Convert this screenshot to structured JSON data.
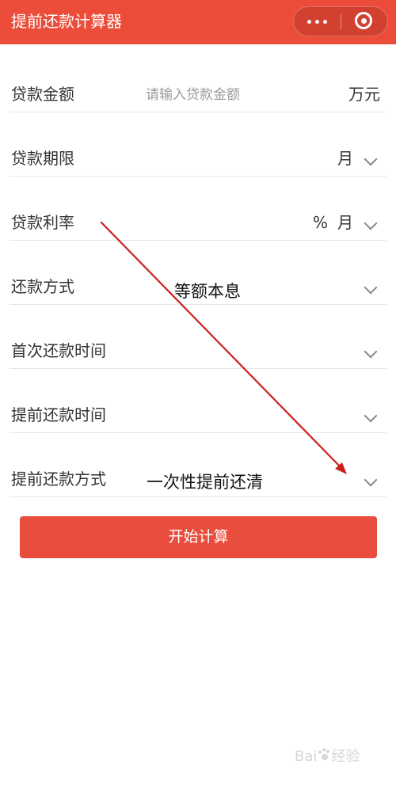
{
  "header": {
    "title": "提前还款计算器",
    "more_icon": "more-dots-icon",
    "close_icon": "target-close-icon"
  },
  "form": {
    "loan_amount": {
      "label": "贷款金额",
      "placeholder": "请输入贷款金额",
      "value": "",
      "unit": "万元"
    },
    "loan_term": {
      "label": "贷款期限",
      "unit": "月"
    },
    "loan_rate": {
      "label": "贷款利率",
      "percent": "%",
      "unit": "月"
    },
    "repay_method": {
      "label": "还款方式",
      "selected": "等额本息"
    },
    "first_repay_time": {
      "label": "首次还款时间"
    },
    "prepay_time": {
      "label": "提前还款时间"
    },
    "prepay_method": {
      "label": "提前还款方式",
      "selected": "一次性提前还清"
    }
  },
  "submit_button": {
    "label": "开始计算"
  },
  "annotation": {
    "color": "#cc1f1f"
  },
  "watermark": {
    "text": "Bai",
    "suffix": "经验"
  },
  "colors": {
    "brand": "#ec4d3b",
    "button": "#e84d3d"
  }
}
